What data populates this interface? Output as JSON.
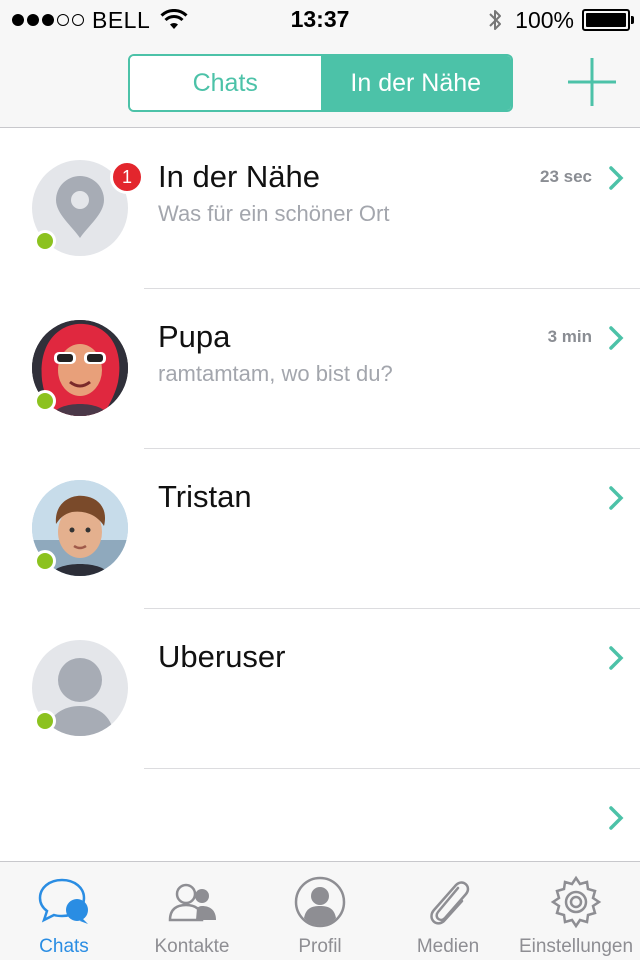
{
  "status_bar": {
    "carrier": "BELL",
    "time": "13:37",
    "battery": "100%",
    "signal_bars_filled": 3,
    "signal_bars_total": 5
  },
  "nav": {
    "segments": [
      "Chats",
      "In der Nähe"
    ],
    "active_segment": "In der Nähe",
    "add_icon": "plus-icon"
  },
  "chats": [
    {
      "name": "In der Nähe",
      "message": "Was für ein schöner Ort",
      "time": "23 sec",
      "badge": "1",
      "online": true,
      "avatar": "location-pin-icon"
    },
    {
      "name": "Pupa",
      "message": "ramtamtam, wo bist du?",
      "time": "3 min",
      "badge": "",
      "online": true,
      "avatar": "user-photo"
    },
    {
      "name": "Tristan",
      "message": "",
      "time": "",
      "badge": "",
      "online": true,
      "avatar": "user-photo"
    },
    {
      "name": "Uberuser",
      "message": "",
      "time": "",
      "badge": "",
      "online": true,
      "avatar": "default-user-icon"
    },
    {
      "name": "",
      "message": "",
      "time": "",
      "badge": "",
      "online": false,
      "avatar": ""
    }
  ],
  "tabs": [
    {
      "label": "Chats",
      "icon": "chat-bubbles-icon",
      "active": true
    },
    {
      "label": "Kontakte",
      "icon": "contacts-icon",
      "active": false
    },
    {
      "label": "Profil",
      "icon": "profile-icon",
      "active": false
    },
    {
      "label": "Medien",
      "icon": "paperclip-icon",
      "active": false
    },
    {
      "label": "Einstellungen",
      "icon": "gear-icon",
      "active": false
    }
  ],
  "colors": {
    "accent": "#4cc2a8",
    "online": "#8cc21f",
    "badge": "#e3262d",
    "tab_active": "#2a8de3"
  }
}
